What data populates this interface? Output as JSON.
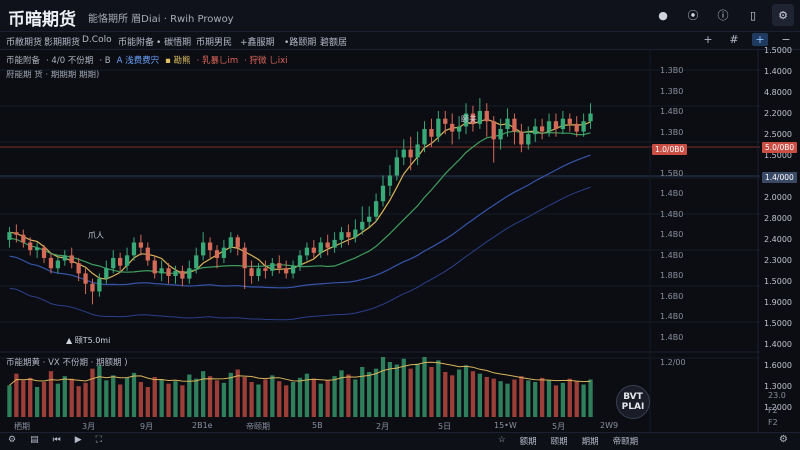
{
  "app": {
    "title": "币暗期货",
    "subtitle": "能恪期所 眉Diai  ·  Rwih Prowoy"
  },
  "top_icons": [
    {
      "name": "record-icon",
      "glyph": "●"
    },
    {
      "name": "navigate-icon",
      "glyph": "⦿"
    },
    {
      "name": "info-icon",
      "glyph": "ⓘ"
    },
    {
      "name": "phone-icon",
      "glyph": "▯"
    },
    {
      "name": "settings-icon",
      "glyph": "⚙"
    }
  ],
  "toolbar": {
    "items": [
      "币敝期货",
      "影期期货",
      "D.Colo",
      "币能附备",
      "• 碳悟期",
      "币期男民",
      "+鑫服期",
      "•路颐期",
      "碧额居"
    ],
    "right": [
      {
        "name": "plus-icon",
        "glyph": "+",
        "active": false
      },
      {
        "name": "grid-icon",
        "glyph": "#",
        "active": false
      },
      {
        "name": "crosshair-icon",
        "glyph": "+",
        "active": true
      },
      {
        "name": "minus-icon",
        "glyph": "−",
        "active": false
      }
    ]
  },
  "legend": {
    "line1": [
      "币能附备",
      "· 4/0 不份期",
      "· B",
      "A 浅费费宍",
      "▪ 勘熊",
      "· 乳暴乚im",
      "· 狩微 乚ixi"
    ],
    "line2": "府能期 货 · 期期期 期期)"
  },
  "axis": {
    "inner_labels": [
      "1.3B0",
      "1.3B0",
      "1.4B0",
      "1.3B0",
      "1.500",
      "1.5B0",
      "1.4B0",
      "1.4B0",
      "1.4B0",
      "1.4B0",
      "1.8B0",
      "1.6B0",
      "1.4B0",
      "1.4B0"
    ],
    "outer_labels": [
      "1.5000",
      "1.4000",
      "4.8000",
      "2.2000",
      "2.5000",
      "1.5000",
      "1.8000",
      "2.0000",
      "2.8000",
      "2.4000",
      "2.3000",
      "1.5000",
      "1.9000",
      "1.5000",
      "1.4000",
      "1.6000",
      "1.3000",
      "1.2000"
    ],
    "vol_labels": [
      "1.2/00",
      "23.0",
      "F2",
      "F2"
    ]
  },
  "price_tags": [
    {
      "text": "1.0/0B0",
      "color": "#c94f45"
    },
    {
      "text": "5.0/0B0",
      "color": "#c94f45"
    },
    {
      "text": "1.4/000",
      "color": "#3a4a66"
    }
  ],
  "annotations": {
    "peak": "颐夫",
    "trough": "▲ 颐T5.0mi",
    "low_left": "爪人"
  },
  "volume": {
    "legend": "币能期黄  ·  VX 不份期  · 期额期 )"
  },
  "x_labels": [
    "栖期",
    "3月",
    "9月",
    "2B1e",
    "帝颐期",
    "5B",
    "2月",
    "5日",
    "15•W",
    "5月",
    "2W9"
  ],
  "bottombar": {
    "left": [
      {
        "name": "settings-icon",
        "glyph": "⚙"
      },
      {
        "name": "menu-icon",
        "glyph": "▤"
      },
      {
        "name": "skip-icon",
        "glyph": "⏮"
      },
      {
        "name": "play-icon",
        "glyph": "▶"
      },
      {
        "name": "fullscreen-icon",
        "glyph": "⛶"
      }
    ],
    "right": [
      "☆",
      "额期",
      "颐期",
      "期期",
      "帝颐期"
    ],
    "corner": "⚙"
  },
  "badge": {
    "line1": "BVT",
    "line2": "PLAI"
  },
  "chart_data": {
    "type": "candlestick",
    "candles": [
      [
        1.63,
        1.66,
        1.6,
        1.68
      ],
      [
        1.66,
        1.65,
        1.62,
        1.69
      ],
      [
        1.65,
        1.62,
        1.6,
        1.67
      ],
      [
        1.62,
        1.59,
        1.57,
        1.64
      ],
      [
        1.59,
        1.6,
        1.56,
        1.62
      ],
      [
        1.6,
        1.56,
        1.54,
        1.61
      ],
      [
        1.56,
        1.52,
        1.5,
        1.58
      ],
      [
        1.52,
        1.55,
        1.5,
        1.57
      ],
      [
        1.55,
        1.57,
        1.53,
        1.59
      ],
      [
        1.57,
        1.54,
        1.52,
        1.6
      ],
      [
        1.54,
        1.5,
        1.47,
        1.56
      ],
      [
        1.5,
        1.46,
        1.42,
        1.52
      ],
      [
        1.46,
        1.43,
        1.38,
        1.48
      ],
      [
        1.43,
        1.48,
        1.41,
        1.5
      ],
      [
        1.48,
        1.52,
        1.46,
        1.55
      ],
      [
        1.52,
        1.56,
        1.5,
        1.59
      ],
      [
        1.56,
        1.53,
        1.51,
        1.58
      ],
      [
        1.53,
        1.57,
        1.51,
        1.6
      ],
      [
        1.57,
        1.62,
        1.55,
        1.64
      ],
      [
        1.62,
        1.6,
        1.57,
        1.65
      ],
      [
        1.6,
        1.55,
        1.53,
        1.62
      ],
      [
        1.55,
        1.5,
        1.48,
        1.57
      ],
      [
        1.5,
        1.52,
        1.47,
        1.55
      ],
      [
        1.52,
        1.49,
        1.46,
        1.54
      ],
      [
        1.49,
        1.51,
        1.46,
        1.53
      ],
      [
        1.51,
        1.48,
        1.45,
        1.53
      ],
      [
        1.48,
        1.52,
        1.46,
        1.55
      ],
      [
        1.52,
        1.57,
        1.5,
        1.6
      ],
      [
        1.57,
        1.62,
        1.55,
        1.66
      ],
      [
        1.62,
        1.59,
        1.56,
        1.64
      ],
      [
        1.59,
        1.56,
        1.52,
        1.61
      ],
      [
        1.56,
        1.6,
        1.54,
        1.63
      ],
      [
        1.6,
        1.64,
        1.58,
        1.66
      ],
      [
        1.64,
        1.6,
        1.57,
        1.65
      ],
      [
        1.6,
        1.52,
        1.44,
        1.62
      ],
      [
        1.52,
        1.49,
        1.46,
        1.55
      ],
      [
        1.49,
        1.52,
        1.47,
        1.54
      ],
      [
        1.52,
        1.51,
        1.48,
        1.55
      ],
      [
        1.51,
        1.54,
        1.49,
        1.56
      ],
      [
        1.54,
        1.52,
        1.5,
        1.57
      ],
      [
        1.52,
        1.5,
        1.48,
        1.55
      ],
      [
        1.5,
        1.53,
        1.48,
        1.55
      ],
      [
        1.53,
        1.57,
        1.51,
        1.59
      ],
      [
        1.57,
        1.6,
        1.55,
        1.62
      ],
      [
        1.6,
        1.58,
        1.56,
        1.63
      ],
      [
        1.58,
        1.62,
        1.56,
        1.64
      ],
      [
        1.62,
        1.6,
        1.57,
        1.65
      ],
      [
        1.6,
        1.63,
        1.58,
        1.66
      ],
      [
        1.63,
        1.66,
        1.6,
        1.68
      ],
      [
        1.66,
        1.64,
        1.61,
        1.69
      ],
      [
        1.64,
        1.67,
        1.62,
        1.71
      ],
      [
        1.67,
        1.7,
        1.65,
        1.76
      ],
      [
        1.7,
        1.72,
        1.68,
        1.76
      ],
      [
        1.72,
        1.78,
        1.7,
        1.81
      ],
      [
        1.78,
        1.84,
        1.76,
        1.88
      ],
      [
        1.84,
        1.88,
        1.8,
        1.92
      ],
      [
        1.88,
        1.95,
        1.86,
        1.98
      ],
      [
        1.95,
        1.98,
        1.92,
        2.02
      ],
      [
        1.98,
        1.95,
        1.9,
        2.03
      ],
      [
        1.95,
        2.0,
        1.92,
        2.05
      ],
      [
        2.0,
        2.06,
        1.97,
        2.09
      ],
      [
        2.06,
        2.03,
        1.99,
        2.1
      ],
      [
        2.03,
        2.1,
        2.01,
        2.13
      ],
      [
        2.1,
        2.08,
        2.04,
        2.13
      ],
      [
        2.08,
        2.05,
        2.0,
        2.12
      ],
      [
        2.05,
        2.07,
        2.02,
        2.11
      ],
      [
        2.07,
        2.12,
        2.04,
        2.16
      ],
      [
        2.12,
        2.08,
        2.05,
        2.15
      ],
      [
        2.08,
        2.13,
        2.06,
        2.18
      ],
      [
        2.13,
        2.09,
        2.03,
        2.16
      ],
      [
        2.09,
        2.02,
        1.93,
        2.11
      ],
      [
        2.02,
        2.06,
        1.98,
        2.1
      ],
      [
        2.06,
        2.1,
        2.03,
        2.14
      ],
      [
        2.1,
        2.05,
        2.0,
        2.12
      ],
      [
        2.05,
        2.0,
        1.97,
        2.08
      ],
      [
        2.0,
        2.04,
        1.98,
        2.07
      ],
      [
        2.04,
        2.07,
        2.01,
        2.1
      ],
      [
        2.07,
        2.05,
        2.02,
        2.1
      ],
      [
        2.05,
        2.09,
        2.03,
        2.12
      ],
      [
        2.09,
        2.06,
        2.03,
        2.12
      ],
      [
        2.06,
        2.1,
        2.04,
        2.13
      ],
      [
        2.1,
        2.08,
        2.05,
        2.12
      ],
      [
        2.08,
        2.05,
        2.03,
        2.11
      ],
      [
        2.05,
        2.09,
        2.03,
        2.12
      ],
      [
        2.09,
        2.12,
        2.06,
        2.16
      ]
    ],
    "volumes": [
      38,
      52,
      44,
      47,
      36,
      42,
      55,
      40,
      49,
      46,
      37,
      41,
      58,
      62,
      44,
      50,
      39,
      47,
      53,
      42,
      36,
      48,
      45,
      40,
      43,
      38,
      51,
      46,
      55,
      49,
      44,
      41,
      53,
      57,
      48,
      42,
      39,
      45,
      50,
      43,
      38,
      42,
      47,
      52,
      46,
      40,
      44,
      49,
      56,
      51,
      45,
      60,
      54,
      58,
      72,
      66,
      63,
      70,
      58,
      64,
      72,
      60,
      68,
      54,
      50,
      57,
      62,
      55,
      52,
      48,
      46,
      43,
      40,
      45,
      49,
      44,
      42,
      47,
      44,
      38,
      41,
      46,
      43,
      39,
      45
    ],
    "ylim": [
      1.3,
      2.25
    ]
  }
}
